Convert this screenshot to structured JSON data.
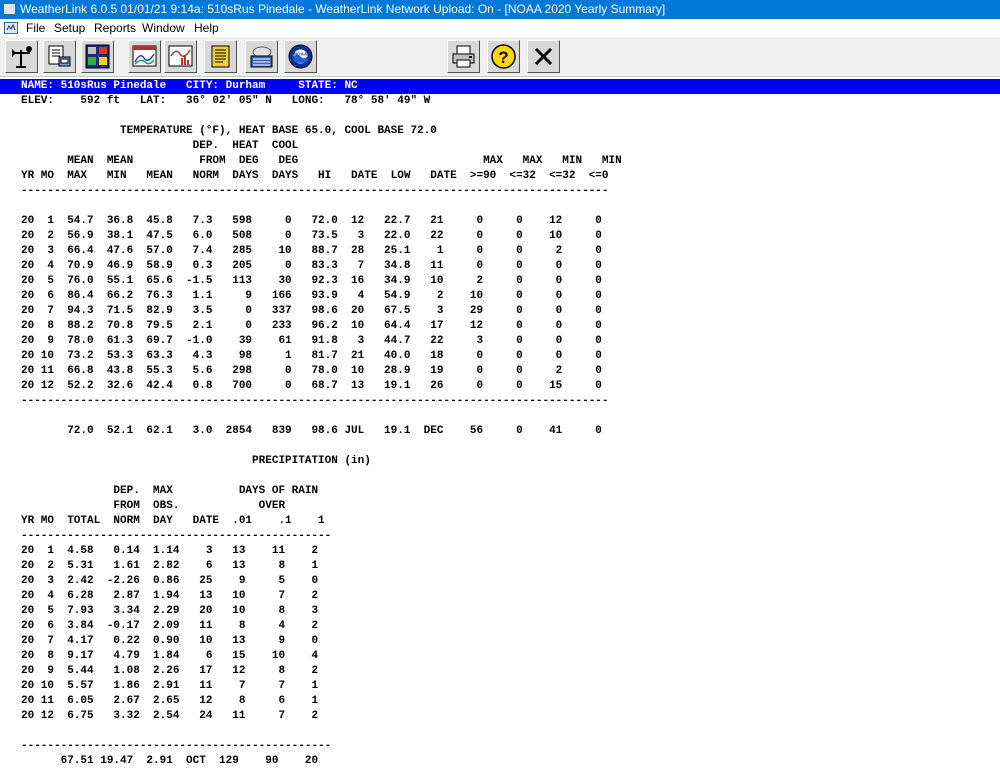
{
  "window": {
    "title": "WeatherLink 6.0.5  01/01/21   9:14a: 510sRus Pinedale - WeatherLink Network Upload: On - [NOAA 2020 Yearly Summary]"
  },
  "menu": {
    "items": [
      "File",
      "Setup",
      "Reports",
      "Window",
      "Help"
    ]
  },
  "toolbar": {
    "buttons": [
      "station-select-icon",
      "download-icon",
      "bulletin-icon",
      "strip-chart-icon",
      "plot-icon",
      "browse-icon",
      "summaries-icon",
      "noaa-icon",
      "print-icon",
      "help-icon",
      "close-icon"
    ],
    "noaa_badge": "NOAA"
  },
  "station": {
    "header": "NAME: 510sRus Pinedale   CITY: Durham     STATE: NC",
    "elevation": "ELEV:    592 ft   LAT:   36° 02' 05\" N   LONG:   78° 58' 49\" W"
  },
  "report": {
    "temperature_title": "               TEMPERATURE (°F), HEAT BASE 65.0, COOL BASE 72.0",
    "temperature_columns": [
      "                          DEP.  HEAT  COOL",
      "       MEAN  MEAN          FROM  DEG   DEG                            MAX   MAX   MIN   MIN",
      "YR MO  MAX   MIN   MEAN   NORM  DAYS  DAYS   HI   DATE  LOW   DATE  >=90  <=32  <=32  <=0"
    ],
    "temperature_separator": "-----------------------------------------------------------------------------------------",
    "temperature_rows": [
      "20  1  54.7  36.8  45.8   7.3   598     0   72.0  12   22.7   21     0     0    12     0",
      "20  2  56.9  38.1  47.5   6.0   508     0   73.5   3   22.0   22     0     0    10     0",
      "20  3  66.4  47.6  57.0   7.4   285    10   88.7  28   25.1    1     0     0     2     0",
      "20  4  70.9  46.9  58.9   0.3   205     0   83.3   7   34.8   11     0     0     0     0",
      "20  5  76.0  55.1  65.6  -1.5   113    30   92.3  16   34.9   10     2     0     0     0",
      "20  6  86.4  66.2  76.3   1.1     9   166   93.9   4   54.9    2    10     0     0     0",
      "20  7  94.3  71.5  82.9   3.5     0   337   98.6  20   67.5    3    29     0     0     0",
      "20  8  88.2  70.8  79.5   2.1     0   233   96.2  10   64.4   17    12     0     0     0",
      "20  9  78.0  61.3  69.7  -1.0    39    61   91.8   3   44.7   22     3     0     0     0",
      "20 10  73.2  53.3  63.3   4.3    98     1   81.7  21   40.0   18     0     0     0     0",
      "20 11  66.8  43.8  55.3   5.6   298     0   78.0  10   28.9   19     0     0     2     0",
      "20 12  52.2  32.6  42.4   0.8   700     0   68.7  13   19.1   26     0     0    15     0"
    ],
    "temperature_total": "       72.0  52.1  62.1   3.0  2854   839   98.6 JUL   19.1  DEC    56     0    41     0",
    "precip_title": "                                   PRECIPITATION (in)",
    "precip_columns": [
      "              DEP.  MAX          DAYS OF RAIN",
      "              FROM  OBS.            OVER",
      "YR MO  TOTAL  NORM  DAY   DATE  .01    .1    1"
    ],
    "precip_separator": "-----------------------------------------------",
    "precip_rows": [
      "20  1  4.58   0.14  1.14    3   13    11    2",
      "20  2  5.31   1.61  2.82    6   13     8    1",
      "20  3  2.42  -2.26  0.86   25    9     5    0",
      "20  4  6.28   2.87  1.94   13   10     7    2",
      "20  5  7.93   3.34  2.29   20   10     8    3",
      "20  6  3.84  -0.17  2.09   11    8     4    2",
      "20  7  4.17   0.22  0.90   10   13     9    0",
      "20  8  9.17   4.79  1.84    6   15    10    4",
      "20  9  5.44   1.08  2.26   17   12     8    2",
      "20 10  5.57   1.86  2.91   11    7     7    1",
      "20 11  6.05   2.67  2.65   12    8     6    1",
      "20 12  6.75   3.32  2.54   24   11     7    2"
    ],
    "precip_total": "      67.51 19.47  2.91  OCT  129    90    20"
  }
}
